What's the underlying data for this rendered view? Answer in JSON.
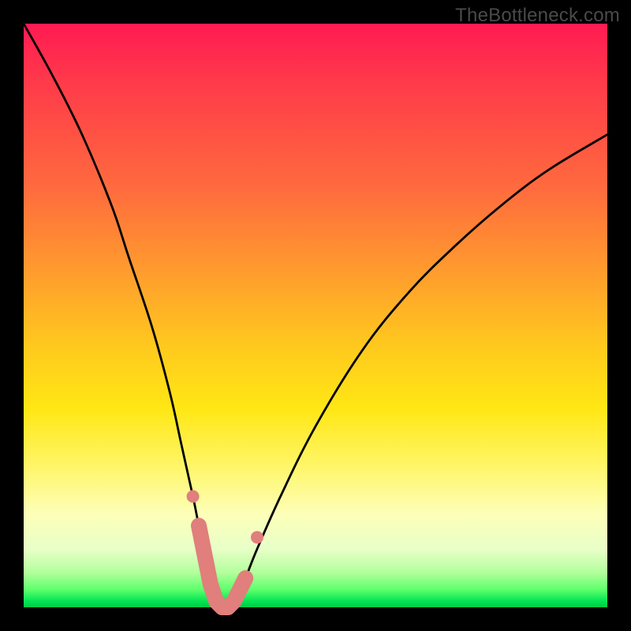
{
  "watermark": "TheBottleneck.com",
  "colors": {
    "gradient_top": "#ff1a52",
    "gradient_mid": "#ffe714",
    "gradient_bottom": "#00c846",
    "curve": "#000000",
    "marker_fill": "#e07f7c",
    "marker_stroke": "#d86f6c",
    "background": "#000000"
  },
  "chart_data": {
    "type": "line",
    "title": "",
    "xlabel": "",
    "ylabel": "",
    "xlim": [
      0,
      100
    ],
    "ylim": [
      0,
      100
    ],
    "grid": false,
    "legend": false,
    "note": "Bottleneck curve: y≈100 at edges, dips to ~0 at x≈34; implied scale (no visible ticks).",
    "series": [
      {
        "name": "bottleneck-curve",
        "x": [
          0,
          5,
          10,
          15,
          18,
          22,
          25,
          27,
          29,
          30,
          31,
          32,
          33,
          34,
          35,
          36,
          37,
          38,
          40,
          44,
          50,
          58,
          66,
          74,
          82,
          90,
          100
        ],
        "values": [
          100,
          91,
          81,
          69,
          60,
          48,
          37,
          28,
          19,
          14,
          9,
          4,
          1,
          0,
          0,
          1,
          3,
          5,
          10,
          19,
          31,
          44,
          54,
          62,
          69,
          75,
          81
        ]
      }
    ],
    "markers": {
      "name": "highlight-segment",
      "note": "Thick pink segment + dots near valley (approx x 29–38, y 0–14).",
      "points": [
        {
          "x": 29,
          "y": 19
        },
        {
          "x": 30,
          "y": 14
        },
        {
          "x": 31,
          "y": 9
        },
        {
          "x": 32,
          "y": 4
        },
        {
          "x": 33,
          "y": 1
        },
        {
          "x": 34,
          "y": 0
        },
        {
          "x": 35,
          "y": 0
        },
        {
          "x": 36,
          "y": 1
        },
        {
          "x": 37,
          "y": 3
        },
        {
          "x": 38,
          "y": 5
        },
        {
          "x": 40,
          "y": 12
        }
      ]
    }
  }
}
